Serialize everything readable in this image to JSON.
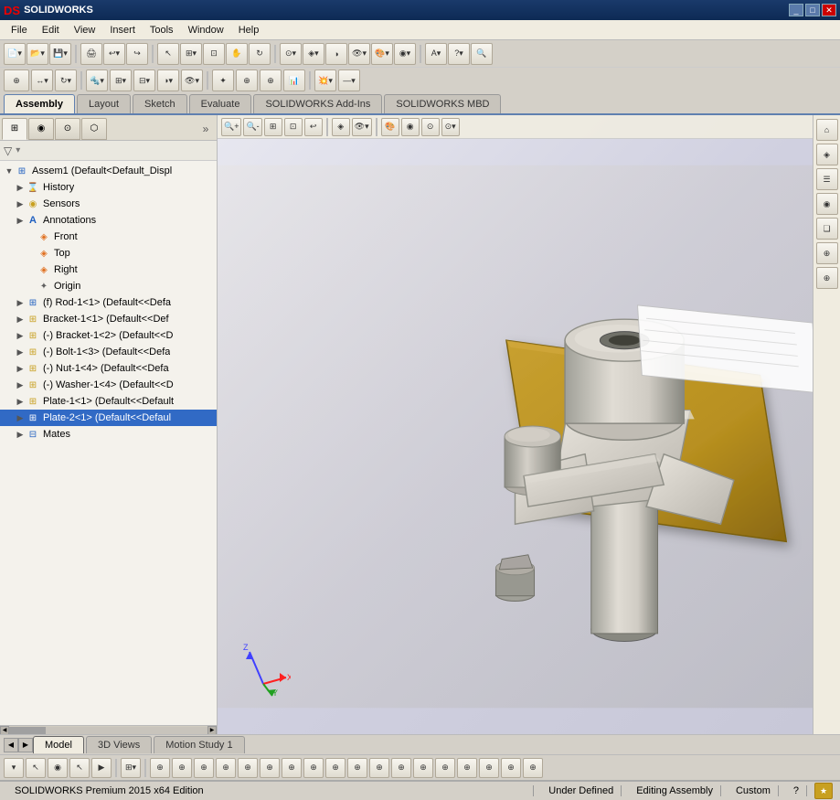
{
  "titlebar": {
    "logo": "DS SOLIDWORKS",
    "title": "",
    "win_controls": [
      "_",
      "□",
      "✕"
    ]
  },
  "menubar": {
    "items": [
      "File",
      "Edit",
      "View",
      "Insert",
      "Tools",
      "Window",
      "Help"
    ]
  },
  "toolbar1": {
    "groups": [
      {
        "buttons": [
          "⊕",
          "▾",
          "⊕▾",
          "▾",
          "⊕▾"
        ]
      },
      {
        "buttons": [
          "⟲",
          "⊕▾",
          "⊕▾",
          "⊕▾",
          "⊕▾"
        ]
      },
      {
        "buttons": [
          "⊕",
          "⊕▾",
          "⊕▾"
        ]
      },
      {
        "buttons": [
          "⊕",
          "⊕▾",
          "⊕▾",
          "⊕▾",
          "⊕▾",
          "⊕▾"
        ]
      },
      {
        "buttons": [
          "A▾",
          "?▾",
          "⊕",
          "⊕",
          "⊕"
        ]
      }
    ]
  },
  "tabs": [
    {
      "label": "Assembly",
      "active": true
    },
    {
      "label": "Layout",
      "active": false
    },
    {
      "label": "Sketch",
      "active": false
    },
    {
      "label": "Evaluate",
      "active": false
    },
    {
      "label": "SOLIDWORKS Add-Ins",
      "active": false
    },
    {
      "label": "SOLIDWORKS MBD",
      "active": false
    }
  ],
  "left_panel": {
    "panel_tabs": [
      "⊞",
      "◉",
      "⊙",
      "⬡",
      "★"
    ],
    "filter_placeholder": "Filter",
    "tree": [
      {
        "id": "root",
        "label": "Assem1 (Default<Default_Displ",
        "level": 0,
        "expand": "▼",
        "icon": "⊞",
        "icon_class": "icon-blue",
        "selected": false
      },
      {
        "id": "history",
        "label": "History",
        "level": 1,
        "expand": "▶",
        "icon": "⌛",
        "icon_class": "icon-gray",
        "selected": false
      },
      {
        "id": "sensors",
        "label": "Sensors",
        "level": 1,
        "expand": "▶",
        "icon": "◉",
        "icon_class": "icon-yellow",
        "selected": false
      },
      {
        "id": "annotations",
        "label": "Annotations",
        "level": 1,
        "expand": "▶",
        "icon": "A",
        "icon_class": "icon-blue",
        "selected": false
      },
      {
        "id": "front",
        "label": "Front",
        "level": 2,
        "expand": "",
        "icon": "◈",
        "icon_class": "icon-orange",
        "selected": false
      },
      {
        "id": "top",
        "label": "Top",
        "level": 2,
        "expand": "",
        "icon": "◈",
        "icon_class": "icon-orange",
        "selected": false
      },
      {
        "id": "right",
        "label": "Right",
        "level": 2,
        "expand": "",
        "icon": "◈",
        "icon_class": "icon-orange",
        "selected": false
      },
      {
        "id": "origin",
        "label": "Origin",
        "level": 2,
        "expand": "",
        "icon": "✦",
        "icon_class": "icon-gray",
        "selected": false
      },
      {
        "id": "rod",
        "label": "(f) Rod-1<1> (Default<<Defa",
        "level": 1,
        "expand": "▶",
        "icon": "⊞",
        "icon_class": "icon-blue",
        "selected": false
      },
      {
        "id": "bracket1",
        "label": "Bracket-1<1> (Default<<Def",
        "level": 1,
        "expand": "▶",
        "icon": "⊞",
        "icon_class": "icon-yellow",
        "selected": false
      },
      {
        "id": "bracket2",
        "label": "(-) Bracket-1<2> (Default<<D",
        "level": 1,
        "expand": "▶",
        "icon": "⊞",
        "icon_class": "icon-yellow",
        "selected": false
      },
      {
        "id": "bolt1",
        "label": "(-) Bolt-1<3> (Default<<Defa",
        "level": 1,
        "expand": "▶",
        "icon": "⊞",
        "icon_class": "icon-yellow",
        "selected": false
      },
      {
        "id": "nut1",
        "label": "(-) Nut-1<4> (Default<<Defa",
        "level": 1,
        "expand": "▶",
        "icon": "⊞",
        "icon_class": "icon-yellow",
        "selected": false
      },
      {
        "id": "washer1",
        "label": "(-) Washer-1<4> (Default<<D",
        "level": 1,
        "expand": "▶",
        "icon": "⊞",
        "icon_class": "icon-yellow",
        "selected": false
      },
      {
        "id": "plate1",
        "label": "Plate-1<1> (Default<<Default",
        "level": 1,
        "expand": "▶",
        "icon": "⊞",
        "icon_class": "icon-yellow",
        "selected": false
      },
      {
        "id": "plate2",
        "label": "Plate-2<1> (Default<<Defaul",
        "level": 1,
        "expand": "▶",
        "icon": "⊞",
        "icon_class": "icon-yellow",
        "selected": true
      },
      {
        "id": "mates",
        "label": "Mates",
        "level": 1,
        "expand": "▶",
        "icon": "⊟",
        "icon_class": "icon-blue",
        "selected": false
      }
    ]
  },
  "viewport_toolbar": {
    "buttons": [
      "🔍+",
      "🔍-",
      "⊞",
      "⊡",
      "⊠",
      "⊟",
      "▷",
      "◈",
      "⊕",
      "🎨",
      "👁",
      "⊙",
      "⊙▾"
    ]
  },
  "right_toolbar": {
    "buttons": [
      "⌂",
      "◈",
      "☰",
      "◉",
      "❏",
      "⊕",
      "⊕"
    ]
  },
  "bottom_tabs": {
    "scroll_left": "◀",
    "scroll_right": "▶",
    "tabs": [
      {
        "label": "Model",
        "active": true
      },
      {
        "label": "3D Views",
        "active": false
      },
      {
        "label": "Motion Study 1",
        "active": false
      }
    ]
  },
  "bottom_toolbar": {
    "buttons": [
      "▾",
      "↖",
      "◉",
      "↖",
      "▶",
      "⊞▾",
      "⊕",
      "⊕",
      "⊕",
      "⊕",
      "⊕",
      "⊕",
      "⊕",
      "⊕",
      "⊕",
      "⊕",
      "⊕",
      "⊕",
      "⊕",
      "⊕",
      "⊕",
      "⊕",
      "⊕",
      "⊕",
      "⊕",
      "⊕",
      "⊕",
      "⊕",
      "?"
    ]
  },
  "statusbar": {
    "app_name": "SOLIDWORKS Premium 2015 x64 Edition",
    "status1": "Under Defined",
    "status2": "Editing Assembly",
    "status3": "Custom",
    "help_btn": "?",
    "gold_btn": "★"
  },
  "model": {
    "description": "Assembly with rod, brackets, bolts, nuts, washers, and plates"
  }
}
